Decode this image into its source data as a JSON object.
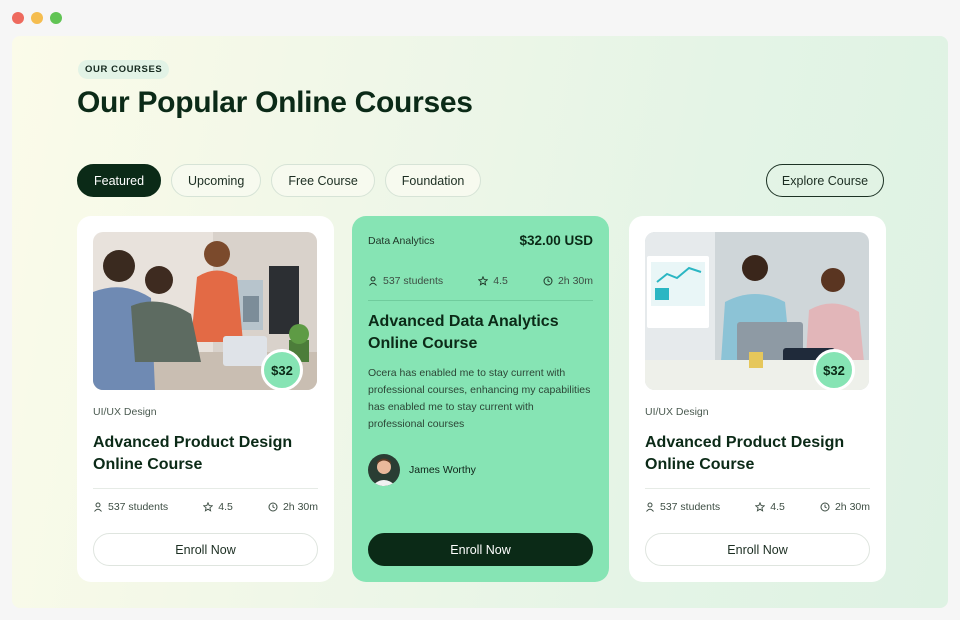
{
  "window": {
    "controls": [
      "close",
      "minimize",
      "maximize"
    ]
  },
  "section": {
    "eyebrow": "OUR COURSES",
    "title": "Our Popular Online Courses"
  },
  "tabs": [
    {
      "label": "Featured",
      "active": true
    },
    {
      "label": "Upcoming",
      "active": false
    },
    {
      "label": "Free Course",
      "active": false
    },
    {
      "label": "Foundation",
      "active": false
    }
  ],
  "explore_label": "Explore Course",
  "cards": [
    {
      "category": "UI/UX Design",
      "title": "Advanced Product Design Online Course",
      "price": "$32",
      "students": "537 students",
      "rating": "4.5",
      "duration": "2h 30m",
      "cta": "Enroll Now",
      "image": "team-meeting-photo"
    },
    {
      "category": "Data Analytics",
      "price": "$32.00 USD",
      "students": "537 students",
      "rating": "4.5",
      "duration": "2h 30m",
      "title": "Advanced Data Analytics Online Course",
      "description": "Ocera has enabled me to stay current with professional courses, enhancing my capabilities has enabled me to stay current with professional courses",
      "author": "James Worthy",
      "cta": "Enroll Now"
    },
    {
      "category": "UI/UX Design",
      "title": "Advanced Product Design Online Course",
      "price": "$32",
      "students": "537 students",
      "rating": "4.5",
      "duration": "2h 30m",
      "cta": "Enroll Now",
      "image": "analytics-desk-photo"
    }
  ],
  "colors": {
    "accent_green": "#86e4b4",
    "dark_green": "#0b2a17",
    "card_white": "#ffffff"
  }
}
